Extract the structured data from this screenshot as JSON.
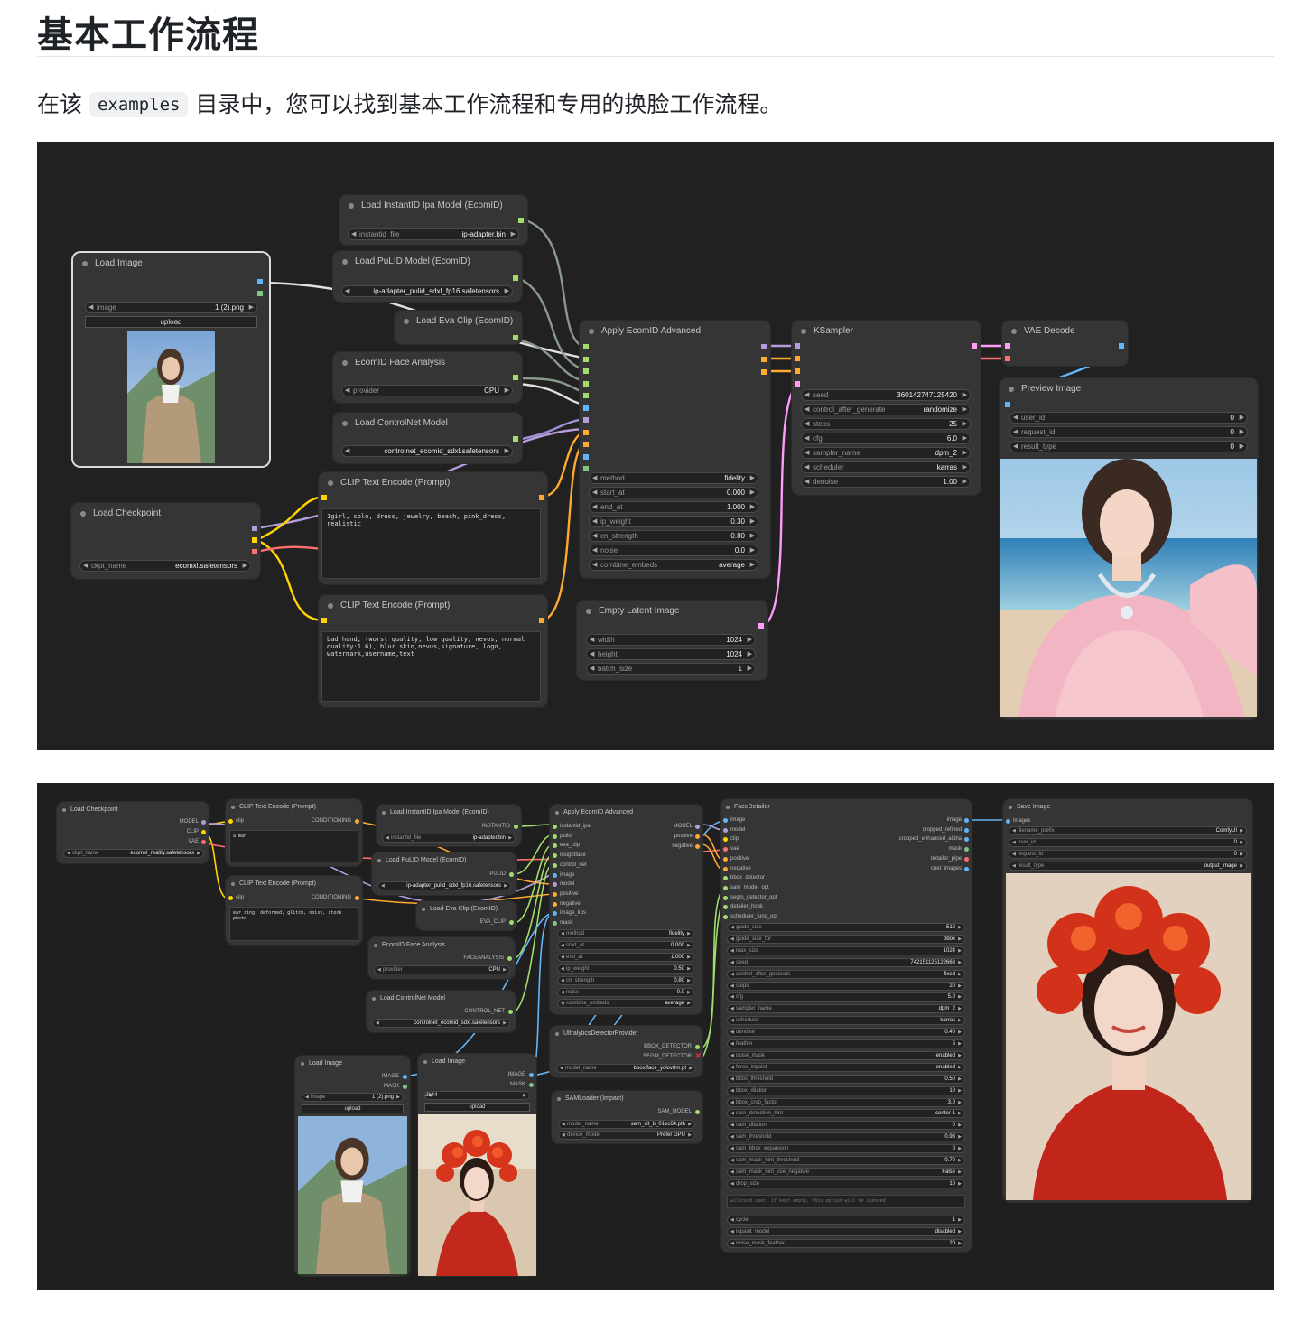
{
  "page": {
    "title": "基本工作流程",
    "intro_before": "在该 ",
    "intro_code": "examples",
    "intro_after": " 目录中，您可以找到基本工作流程和专用的换脸工作流程。"
  },
  "colors": {
    "model": "#b39ddb",
    "clip": "#ffd500",
    "vae": "#ff6e6e",
    "conditioning": "#ffa931",
    "latent": "#ff9cf9",
    "image": "#64b5f6",
    "mask": "#81c784",
    "other": "#a1dd6c"
  },
  "w1": {
    "load_image": {
      "title": "Load Image",
      "image_label": "image",
      "image_value": "1 (2).png",
      "upload": "upload"
    },
    "instantid": {
      "title": "Load InstantID Ipa Model (EcomID)",
      "label": "instantid_file",
      "value": "ip-adapter.bin"
    },
    "pulid": {
      "title": "Load PuLID Model (EcomID)",
      "label": "pulid_file",
      "value": "ip-adapter_pulid_sdxl_fp16.safetensors"
    },
    "eva": {
      "title": "Load Eva Clip (EcomID)"
    },
    "face": {
      "title": "EcomID Face Analysis",
      "label": "provider",
      "value": "CPU"
    },
    "controlnet": {
      "title": "Load ControlNet Model",
      "label": "control_net_name",
      "value": "controlnet_ecomid_sdxl.safetensors"
    },
    "checkpoint": {
      "title": "Load Checkpoint",
      "label": "ckpt_name",
      "value": "ecomxl.safetensors"
    },
    "clip_pos": {
      "title": "CLIP Text Encode (Prompt)",
      "text": "1girl, solo, dress, jewelry, beach, pink_dress, realistic"
    },
    "clip_neg": {
      "title": "CLIP Text Encode (Prompt)",
      "text": "bad hand, (worst quality, low quality, nevus, normal quality:1.6), blur skin,nevus,signature, logo, watermark,username,text"
    },
    "apply": {
      "title": "Apply EcomID Advanced",
      "widgets": [
        {
          "label": "method",
          "value": "fidelity"
        },
        {
          "label": "start_at",
          "value": "0.000"
        },
        {
          "label": "end_at",
          "value": "1.000"
        },
        {
          "label": "ip_weight",
          "value": "0.30"
        },
        {
          "label": "cn_strength",
          "value": "0.80"
        },
        {
          "label": "noise",
          "value": "0.0"
        },
        {
          "label": "combine_embeds",
          "value": "average"
        }
      ]
    },
    "latent": {
      "title": "Empty Latent Image",
      "widgets": [
        {
          "label": "width",
          "value": "1024"
        },
        {
          "label": "height",
          "value": "1024"
        },
        {
          "label": "batch_size",
          "value": "1"
        }
      ]
    },
    "ksampler": {
      "title": "KSampler",
      "widgets": [
        {
          "label": "seed",
          "value": "360142747125420"
        },
        {
          "label": "control_after_generate",
          "value": "randomize"
        },
        {
          "label": "steps",
          "value": "25"
        },
        {
          "label": "cfg",
          "value": "6.0"
        },
        {
          "label": "sampler_name",
          "value": "dpm_2"
        },
        {
          "label": "scheduler",
          "value": "karras"
        },
        {
          "label": "denoise",
          "value": "1.00"
        }
      ]
    },
    "vae_decode": {
      "title": "VAE Decode"
    },
    "preview": {
      "title": "Preview Image",
      "widgets": [
        {
          "label": "user_id",
          "value": "0"
        },
        {
          "label": "request_id",
          "value": "0"
        },
        {
          "label": "result_type",
          "value": "0"
        }
      ]
    }
  },
  "w2": {
    "checkpoint": {
      "title": "Load Checkpoint",
      "outputs": [
        "MODEL",
        "CLIP",
        "VAE"
      ],
      "label": "ckpt_name",
      "value": "ecomxl_reality.safetensors"
    },
    "clip_pos": {
      "title": "CLIP Text Encode (Prompt)",
      "input": "clip",
      "output": "CONDITIONING",
      "text": "a man"
    },
    "clip_neg": {
      "title": "CLIP Text Encode (Prompt)",
      "input": "clip",
      "output": "CONDITIONING",
      "text": "ear ring, deformed, glitch, noisy, stock photo"
    },
    "instantid": {
      "title": "Load InstantID Ipa Model (EcomID)",
      "output": "INSTANTID",
      "label": "instantid_file",
      "value": "ip-adapter.bin"
    },
    "pulid": {
      "title": "Load PuLID Model (EcomID)",
      "output": "PULID",
      "label": "pulid_file",
      "value": "ip-adapter_pulid_sdxl_fp16.safetensors"
    },
    "eva": {
      "title": "Load Eva Clip (EcomID)",
      "output": "EVA_CLIP"
    },
    "face": {
      "title": "EcomID Face Analysis",
      "output": "FACEANALYSIS",
      "label": "provider",
      "value": "CPU"
    },
    "controlnet": {
      "title": "Load ControlNet Model",
      "output": "CONTROL_NET",
      "label": "control_net_name",
      "value": "controlnet_ecomid_sdxl.safetensors"
    },
    "load_a": {
      "title": "Load Image",
      "outputs": [
        "IMAGE",
        "MASK"
      ],
      "label": "image",
      "value": "1 (2).png",
      "upload": "upload"
    },
    "load_b": {
      "title": "Load Image",
      "outputs": [
        "IMAGE",
        "MASK"
      ],
      "label": "image",
      "value": "2b44-Comfyui_temp_oeipa_00181_.png",
      "upload": "upload"
    },
    "apply": {
      "title": "Apply EcomID Advanced",
      "inputs": [
        "instantid_ipa",
        "pulid",
        "eva_clip",
        "insightface",
        "control_net",
        "image",
        "model",
        "positive",
        "negative",
        "image_kps",
        "mask"
      ],
      "outputs": [
        "MODEL",
        "positive",
        "negative"
      ],
      "widgets": [
        {
          "label": "method",
          "value": "fidelity"
        },
        {
          "label": "start_at",
          "value": "0.000"
        },
        {
          "label": "end_at",
          "value": "1.000"
        },
        {
          "label": "ip_weight",
          "value": "0.50"
        },
        {
          "label": "cn_strength",
          "value": "0.80"
        },
        {
          "label": "noise",
          "value": "0.0"
        },
        {
          "label": "combine_embeds",
          "value": "average"
        }
      ]
    },
    "ultra": {
      "title": "UltralyticsDetectorProvider",
      "outputs": [
        "BBOX_DETECTOR",
        "SEGM_DETECTOR"
      ],
      "label": "model_name",
      "value": "bbox/face_yolov8m.pt"
    },
    "sam": {
      "title": "SAMLoader (Impact)",
      "output": "SAM_MODEL",
      "widgets": [
        {
          "label": "model_name",
          "value": "sam_vit_b_01ec64.pth"
        },
        {
          "label": "device_mode",
          "value": "Prefer GPU"
        }
      ]
    },
    "detailer": {
      "title": "FaceDetailer",
      "inputs": [
        "image",
        "model",
        "clip",
        "vae",
        "positive",
        "negative",
        "bbox_detector",
        "sam_model_opt",
        "segm_detector_opt",
        "detailer_hook",
        "scheduler_func_opt"
      ],
      "outputs": [
        "image",
        "cropped_refined",
        "cropped_enhanced_alpha",
        "mask",
        "detailer_pipe",
        "cnet_images"
      ],
      "widgets": [
        {
          "label": "guide_size",
          "value": "512"
        },
        {
          "label": "guide_size_for",
          "value": "bbox"
        },
        {
          "label": "max_size",
          "value": "1024"
        },
        {
          "label": "seed",
          "value": "742151125122668"
        },
        {
          "label": "control_after_generate",
          "value": "fixed"
        },
        {
          "label": "steps",
          "value": "20"
        },
        {
          "label": "cfg",
          "value": "5.0"
        },
        {
          "label": "sampler_name",
          "value": "dpm_2"
        },
        {
          "label": "scheduler",
          "value": "karras"
        },
        {
          "label": "denoise",
          "value": "0.40"
        },
        {
          "label": "feather",
          "value": "5"
        },
        {
          "label": "noise_mask",
          "value": "enabled"
        },
        {
          "label": "force_inpaint",
          "value": "enabled"
        },
        {
          "label": "bbox_threshold",
          "value": "0.50"
        },
        {
          "label": "bbox_dilation",
          "value": "10"
        },
        {
          "label": "bbox_crop_factor",
          "value": "3.0"
        },
        {
          "label": "sam_detection_hint",
          "value": "center-1"
        },
        {
          "label": "sam_dilation",
          "value": "0"
        },
        {
          "label": "sam_threshold",
          "value": "0.93"
        },
        {
          "label": "sam_bbox_expansion",
          "value": "0"
        },
        {
          "label": "sam_mask_hint_threshold",
          "value": "0.70"
        },
        {
          "label": "sam_mask_hint_use_negative",
          "value": "False"
        },
        {
          "label": "drop_size",
          "value": "10"
        }
      ],
      "wildcard": "wildcard spec: if kept empty, this option will be ignored",
      "widgets2": [
        {
          "label": "cycle",
          "value": "1"
        },
        {
          "label": "inpaint_model",
          "value": "disabled"
        },
        {
          "label": "noise_mask_feather",
          "value": "20"
        }
      ]
    },
    "save": {
      "title": "Save Image",
      "input": "images",
      "widgets": [
        {
          "label": "filename_prefix",
          "value": "ComfyUI"
        },
        {
          "label": "user_id",
          "value": "0"
        },
        {
          "label": "request_id",
          "value": "0"
        },
        {
          "label": "result_type",
          "value": "output_image"
        }
      ]
    }
  }
}
